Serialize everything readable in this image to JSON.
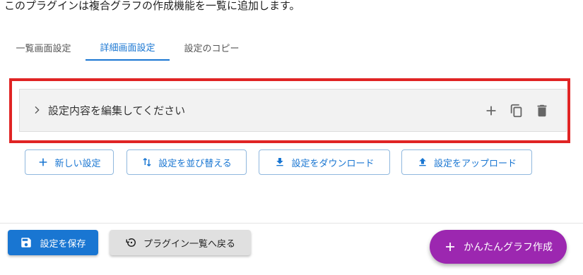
{
  "description": "このプラグインは複合グラフの作成機能を一覧に追加します。",
  "tabs": [
    {
      "label": "一覧画面設定",
      "active": false
    },
    {
      "label": "詳細画面設定",
      "active": true
    },
    {
      "label": "設定のコピー",
      "active": false
    }
  ],
  "accordion": {
    "title": "設定内容を編集してください",
    "icons": [
      "add-icon",
      "copy-icon",
      "delete-icon"
    ]
  },
  "actions": {
    "new_setting": "新しい設定",
    "reorder": "設定を並び替える",
    "download": "設定をダウンロード",
    "upload": "設定をアップロード"
  },
  "footer": {
    "save_label": "設定を保存",
    "back_label": "プラグイン一覧へ戻る",
    "fab_label": "かんたんグラフ作成"
  },
  "colors": {
    "primary": "#1976d2",
    "highlight": "#e02424",
    "fab": "#9c27b0"
  }
}
